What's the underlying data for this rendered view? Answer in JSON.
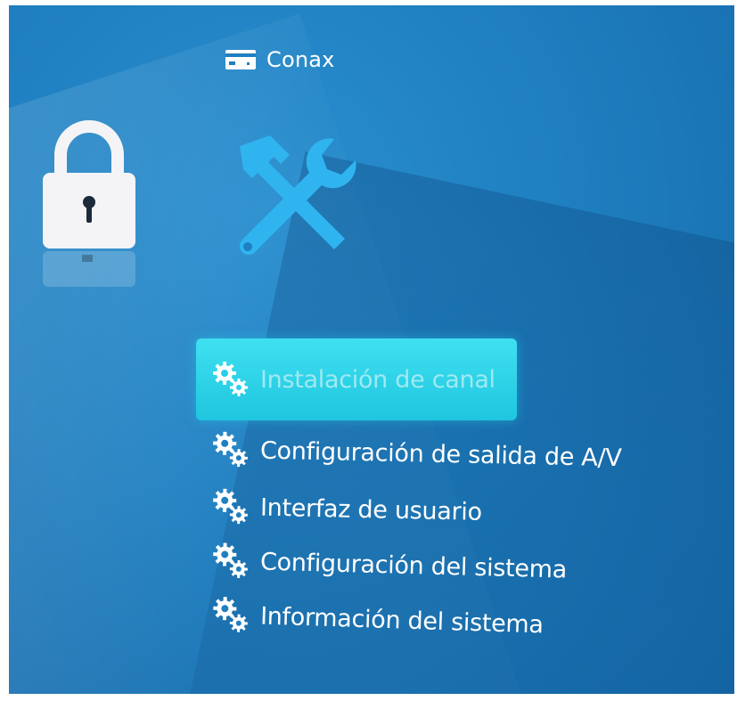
{
  "header": {
    "title": "Conax",
    "icon": "card-icon"
  },
  "menu": {
    "items": [
      {
        "label": "Instalación de canal",
        "icon": "gears-icon",
        "selected": true
      },
      {
        "label": "Configuración de salida de A/V",
        "icon": "gears-icon",
        "selected": false
      },
      {
        "label": "Interfaz de usuario",
        "icon": "gears-icon",
        "selected": false
      },
      {
        "label": "Configuración del sistema",
        "icon": "gears-icon",
        "selected": false
      },
      {
        "label": "Información del sistema",
        "icon": "gears-icon",
        "selected": false
      }
    ]
  },
  "colors": {
    "background": "#1f7fc0",
    "highlight": "#27d0e8",
    "tools_icon": "#2fb4f0",
    "text": "#ffffff"
  }
}
